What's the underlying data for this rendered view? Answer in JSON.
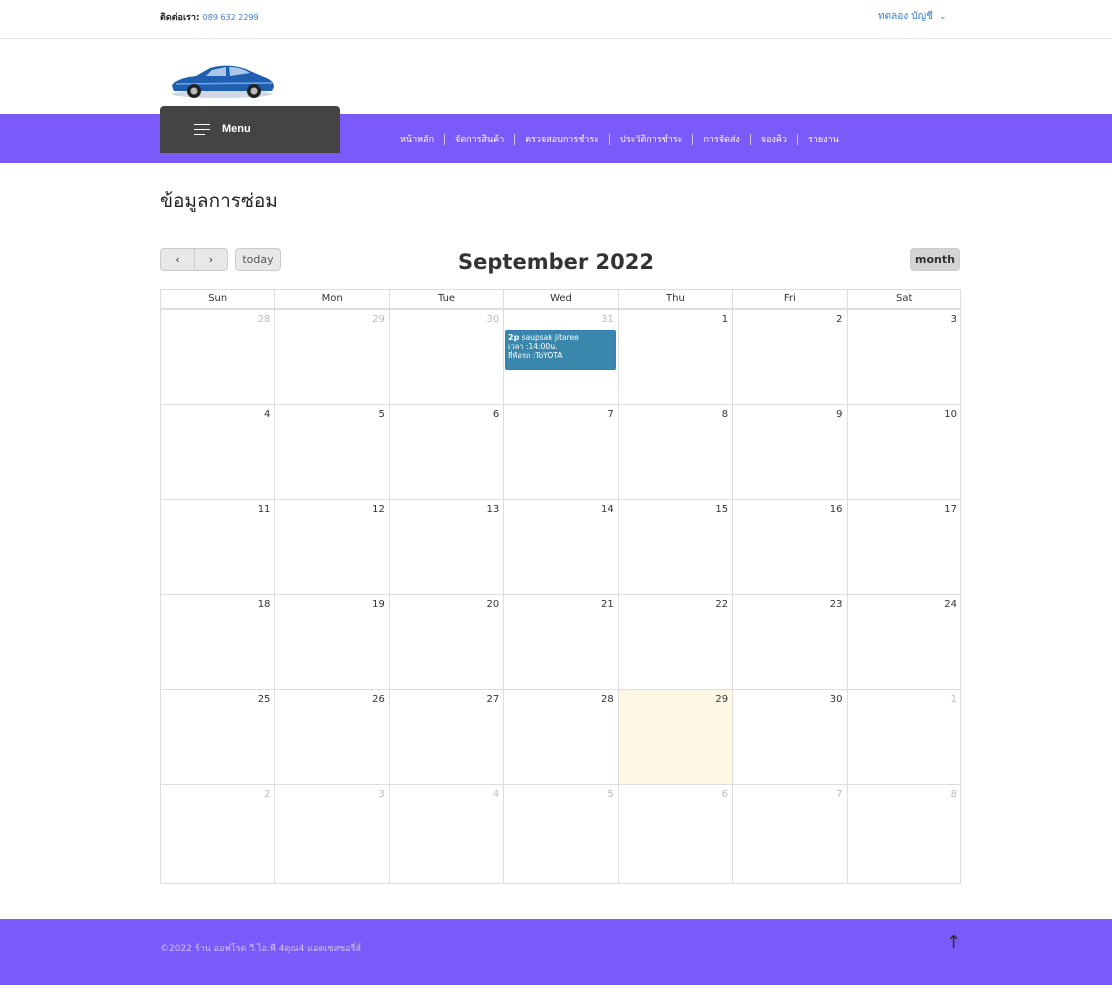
{
  "topbar": {
    "contact_label": "ติดต่อเรา:",
    "contact_phone": "089 632 2299",
    "account_label": "ทดลอง บัญชี"
  },
  "nav": {
    "menu_label": "Menu",
    "links": [
      "หน้าหลัก",
      "จัดการสินค้า",
      "ตรวจสอบการชำระ",
      "ประวัติการชำระ",
      "การจัดส่ง",
      "จองคิว",
      "รายงาน"
    ]
  },
  "page": {
    "title": "ข้อมูลการซ่อม"
  },
  "calendar": {
    "title": "September 2022",
    "today_label": "today",
    "month_label": "month",
    "weekdays": [
      "Sun",
      "Mon",
      "Tue",
      "Wed",
      "Thu",
      "Fri",
      "Sat"
    ],
    "weeks": [
      [
        "28",
        "29",
        "30",
        "31",
        "1",
        "2",
        "3"
      ],
      [
        "4",
        "5",
        "6",
        "7",
        "8",
        "9",
        "10"
      ],
      [
        "11",
        "12",
        "13",
        "14",
        "15",
        "16",
        "17"
      ],
      [
        "18",
        "19",
        "20",
        "21",
        "22",
        "23",
        "24"
      ],
      [
        "25",
        "26",
        "27",
        "28",
        "29",
        "30",
        "1"
      ],
      [
        "2",
        "3",
        "4",
        "5",
        "6",
        "7",
        "8"
      ]
    ],
    "today_date": "29",
    "event": {
      "time": "2p",
      "name": "saupsak jitaree",
      "line2": "เวลา :14:00น.",
      "line3": "ยี่ห้อรถ :ToYOTA"
    }
  },
  "footer": {
    "copyright": "©2022 ร้าน ออฟโรด วี.ไอ.พี 4ดุณ4 แอคเซสซอรี่ส์"
  },
  "colors": {
    "nav_bg": "#7a5af8",
    "menu_bg": "#444444",
    "event_bg": "#3a87ad",
    "today_bg": "#fcf8e3",
    "link_blue": "#3b7dd8"
  }
}
